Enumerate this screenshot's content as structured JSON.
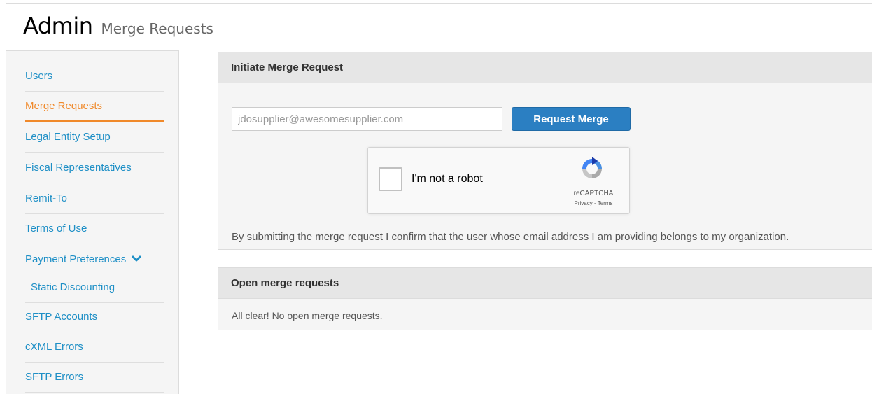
{
  "header": {
    "title": "Admin",
    "subtitle": "Merge Requests"
  },
  "sidebar": {
    "items": [
      {
        "label": "Users"
      },
      {
        "label": "Merge Requests",
        "active": true
      },
      {
        "label": "Legal Entity Setup"
      },
      {
        "label": "Fiscal Representatives"
      },
      {
        "label": "Remit-To"
      },
      {
        "label": "Terms of Use"
      },
      {
        "label": "Payment Preferences",
        "icon": "chevron-down-icon"
      },
      {
        "label": "Static Discounting"
      },
      {
        "label": "SFTP Accounts"
      },
      {
        "label": "cXML Errors"
      },
      {
        "label": "SFTP Errors"
      }
    ]
  },
  "initiate": {
    "title": "Initiate Merge Request",
    "email_placeholder": "jdosupplier@awesomesupplier.com",
    "button_label": "Request Merge",
    "recaptcha": {
      "label": "I'm not a robot",
      "brand": "reCAPTCHA",
      "privacy": "Privacy",
      "separator": " - ",
      "terms": "Terms"
    },
    "confirm_text": "By submitting the merge request I confirm that the user whose email address I am providing belongs to my organization."
  },
  "open_requests": {
    "title": "Open merge requests",
    "empty_text": "All clear! No open merge requests."
  },
  "colors": {
    "link": "#1e8fc6",
    "active": "#f0892a",
    "primary_button": "#2b7fc2"
  }
}
